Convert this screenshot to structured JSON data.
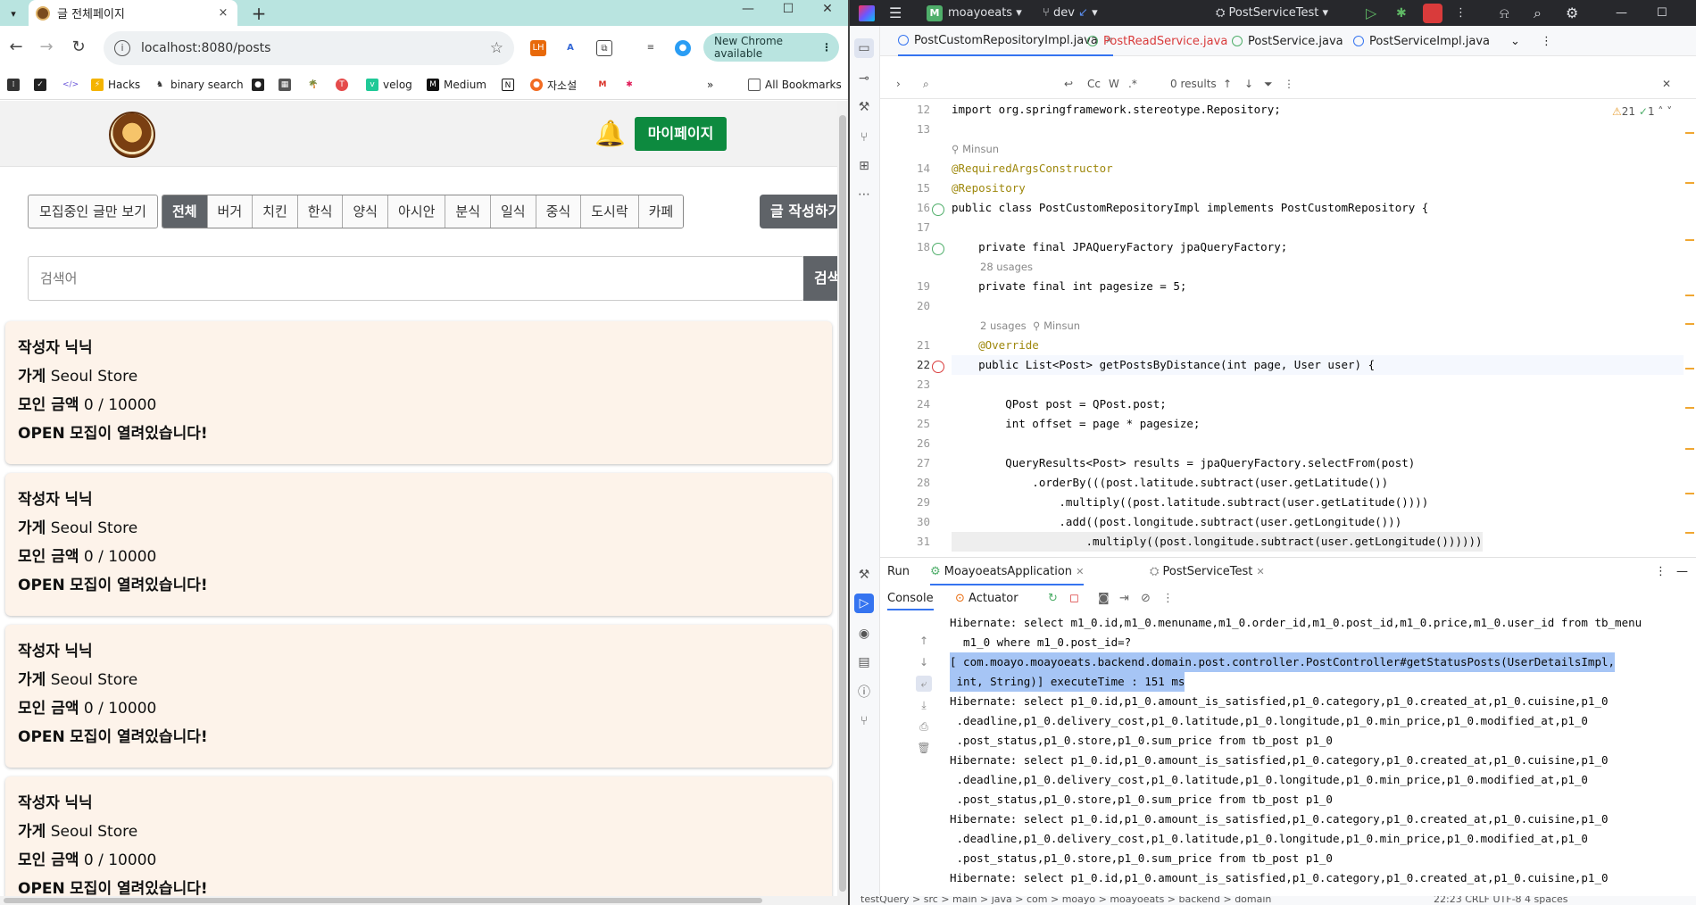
{
  "browser": {
    "tab_title": "글 전체페이지",
    "tab_close": "×",
    "new_tab": "+",
    "url": "localhost:8080/posts",
    "update_chip": "New Chrome available",
    "bookmarks": [
      "Hacks",
      "binary search",
      "velog",
      "Medium",
      "자소설"
    ],
    "all_bookmarks": "All Bookmarks",
    "more_bookmarks": "»"
  },
  "page": {
    "mypage_button": "마이페이지",
    "recruit_only_button": "모집중인 글만 보기",
    "categories": [
      "전체",
      "버거",
      "치킨",
      "한식",
      "양식",
      "아시안",
      "분식",
      "일식",
      "중식",
      "도시락",
      "카페"
    ],
    "active_category": "전체",
    "write_button": "글 작성하기",
    "search_placeholder": "검색어",
    "search_button": "검색",
    "posts": [
      {
        "author_label": "작성자",
        "author": "닉닉",
        "store_label": "가게",
        "store": "Seoul Store",
        "amount_label": "모인 금액",
        "amount": "0 / 10000",
        "status": "OPEN",
        "status_text": "모집이 열려있습니다!"
      },
      {
        "author_label": "작성자",
        "author": "닉닉",
        "store_label": "가게",
        "store": "Seoul Store",
        "amount_label": "모인 금액",
        "amount": "0 / 10000",
        "status": "OPEN",
        "status_text": "모집이 열려있습니다!"
      },
      {
        "author_label": "작성자",
        "author": "닉닉",
        "store_label": "가게",
        "store": "Seoul Store",
        "amount_label": "모인 금액",
        "amount": "0 / 10000",
        "status": "OPEN",
        "status_text": "모집이 열려있습니다!"
      },
      {
        "author_label": "작성자",
        "author": "닉닉",
        "store_label": "가게",
        "store": "Seoul Store",
        "amount_label": "모인 금액",
        "amount": "0 / 10000",
        "status": "OPEN",
        "status_text": "모집이 열려있습니다!"
      }
    ]
  },
  "ide": {
    "project": "moayoeats",
    "project_badge": "M",
    "branch": "dev",
    "run_config": "PostServiceTest",
    "file_tabs": [
      "PostCustomRepositoryImpl.java",
      "PostReadService.java",
      "PostService.java",
      "PostServiceImpl.java"
    ],
    "find_results": "0 results",
    "find_cc": "Cc",
    "find_w": "W",
    "find_regex": ".*",
    "inspection_warnings": "21",
    "inspection_ok": "1",
    "code_lines": [
      {
        "n": "12",
        "text": "import org.springframework.stereotype.Repository;"
      },
      {
        "n": "13",
        "text": ""
      },
      {
        "n": "14",
        "text": "@RequiredArgsConstructor"
      },
      {
        "n": "15",
        "text": "@Repository"
      },
      {
        "n": "16",
        "text": "public class PostCustomRepositoryImpl implements PostCustomRepository {"
      },
      {
        "n": "17",
        "text": ""
      },
      {
        "n": "18",
        "text": "    private final JPAQueryFactory jpaQueryFactory;"
      },
      {
        "n": "19",
        "text": "    private final int pagesize = 5;"
      },
      {
        "n": "20",
        "text": ""
      },
      {
        "n": "21",
        "text": "    @Override"
      },
      {
        "n": "22",
        "text": "    public List<Post> getPostsByDistance(int page, User user) {"
      },
      {
        "n": "23",
        "text": ""
      },
      {
        "n": "24",
        "text": "        QPost post = QPost.post;"
      },
      {
        "n": "25",
        "text": "        int offset = page * pagesize;"
      },
      {
        "n": "26",
        "text": ""
      },
      {
        "n": "27",
        "text": "        QueryResults<Post> results = jpaQueryFactory.selectFrom(post)"
      },
      {
        "n": "28",
        "text": "            .orderBy(((post.latitude.subtract(user.getLatitude())"
      },
      {
        "n": "29",
        "text": "                .multiply((post.latitude.subtract(user.getLatitude())))"
      },
      {
        "n": "30",
        "text": "                .add((post.longitude.subtract(user.getLongitude()))"
      },
      {
        "n": "31",
        "text": "                    .multiply((post.longitude.subtract(user.getLongitude())))))"
      }
    ],
    "hints": {
      "author1": "Minsun",
      "usages28": "28 usages",
      "usages2": "2 usages",
      "author2": "Minsun"
    },
    "run": {
      "run_label": "Run",
      "app_tab": "MoayoeatsApplication",
      "test_tab": "PostServiceTest",
      "console_tab": "Console",
      "actuator_tab": "Actuator",
      "lines": [
        "Hibernate: select m1_0.id,m1_0.menuname,m1_0.order_id,m1_0.post_id,m1_0.price,m1_0.user_id from tb_menu",
        "  m1_0 where m1_0.post_id=?",
        "[ com.moayo.moayoeats.backend.domain.post.controller.PostController#getStatusPosts(UserDetailsImpl,",
        " int, String)] executeTime : 151 ms",
        "Hibernate: select p1_0.id,p1_0.amount_is_satisfied,p1_0.category,p1_0.created_at,p1_0.cuisine,p1_0",
        " .deadline,p1_0.delivery_cost,p1_0.latitude,p1_0.longitude,p1_0.min_price,p1_0.modified_at,p1_0",
        " .post_status,p1_0.store,p1_0.sum_price from tb_post p1_0",
        "Hibernate: select p1_0.id,p1_0.amount_is_satisfied,p1_0.category,p1_0.created_at,p1_0.cuisine,p1_0",
        " .deadline,p1_0.delivery_cost,p1_0.latitude,p1_0.longitude,p1_0.min_price,p1_0.modified_at,p1_0",
        " .post_status,p1_0.store,p1_0.sum_price from tb_post p1_0",
        "Hibernate: select p1_0.id,p1_0.amount_is_satisfied,p1_0.category,p1_0.created_at,p1_0.cuisine,p1_0",
        " .deadline,p1_0.delivery_cost,p1_0.latitude,p1_0.longitude,p1_0.min_price,p1_0.modified_at,p1_0",
        " .post_status,p1_0.store,p1_0.sum_price from tb_post p1_0",
        "Hibernate: select p1_0.id,p1_0.amount_is_satisfied,p1_0.category,p1_0.created_at,p1_0.cuisine,p1_0"
      ]
    },
    "status_bar": "testQuery > src > main > java > com > moayo > moayoeats > backend > domain",
    "status_right": "22:23   CRLF   UTF-8   4 spaces"
  }
}
